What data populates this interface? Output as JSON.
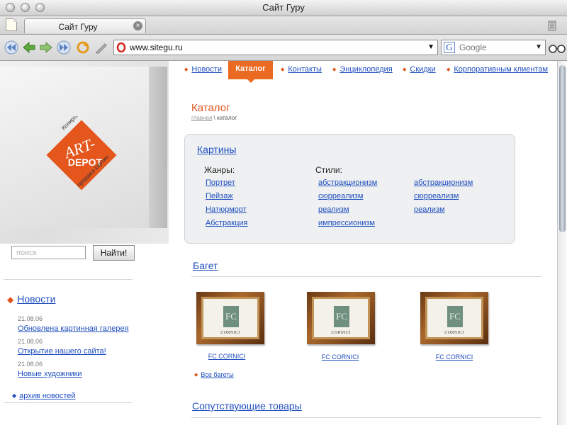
{
  "window": {
    "title": "Сайт Гуру"
  },
  "tabs": [
    {
      "label": "Сайт Гуру"
    }
  ],
  "address_bar": {
    "url": "www.sitegu.ru"
  },
  "search_bar": {
    "placeholder": "Google"
  },
  "site": {
    "menu": [
      {
        "label": "Новости"
      },
      {
        "label": "Каталог",
        "active": true
      },
      {
        "label": "Контакты"
      },
      {
        "label": "Энциклопедия"
      },
      {
        "label": "Скидки"
      },
      {
        "label": "Корпоративным клиентам"
      }
    ],
    "search": {
      "placeholder": "поиск",
      "button": "Найти!"
    },
    "news": {
      "title": "Новости",
      "items": [
        {
          "date": "21.08.06",
          "title": "Обновлена картинная галерея"
        },
        {
          "date": "21.08.06",
          "title": "Открытие нашего сайта!"
        },
        {
          "date": "21.08.06",
          "title": "Новые художники"
        }
      ],
      "archive": "архив новостей"
    },
    "page_title": "Каталог",
    "breadcrumb": {
      "home": "главная",
      "sep": "\\",
      "current": "каталог"
    },
    "paintings": {
      "title": "Картины",
      "genres_head": "Жанры:",
      "genres": [
        "Портрет",
        "Пейзаж",
        "Натюрморт",
        "Абстракция"
      ],
      "styles_head": "Стили:",
      "styles_col1": [
        "абстракционизм",
        "сюрреализм",
        "реализм",
        "импрессионизм"
      ],
      "styles_col2": [
        "абстракционизм",
        "сюрреализм",
        "реализм"
      ]
    },
    "baget": {
      "title": "Багет",
      "products": [
        {
          "label": "FC CORNICI"
        },
        {
          "label": "FC CORNICI"
        },
        {
          "label": "FC CORNICI"
        }
      ],
      "all_link": "Все багеты"
    },
    "related_title": "Сопутствующие товары",
    "logo": {
      "text_top": "Копирование и",
      "text_bottom": "продажа картин",
      "art": "ART-",
      "depot": "DEPOT"
    },
    "frame_text": {
      "fc": "FC",
      "brand": "CORNICI"
    }
  },
  "colors": {
    "accent": "#ea6a21",
    "link": "#1f4fbf"
  }
}
